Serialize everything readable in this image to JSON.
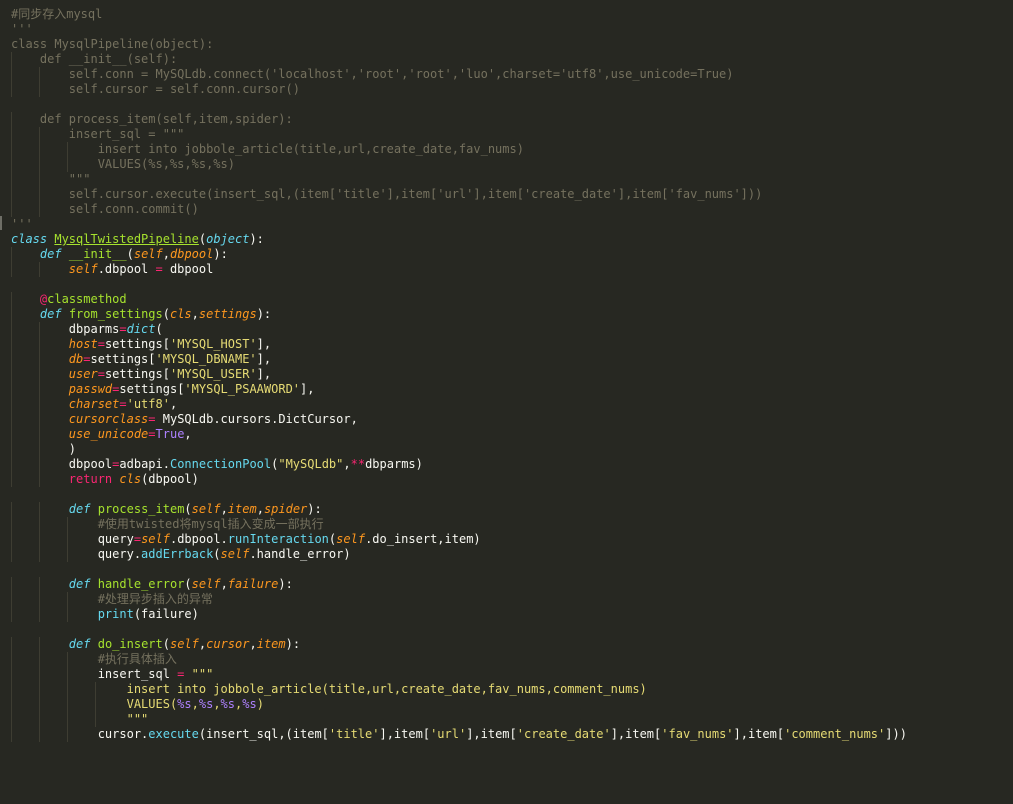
{
  "editor": {
    "theme": {
      "background": "#272822",
      "foreground": "#F8F8F2",
      "comment": "#75715E",
      "keyword": "#66D9EF",
      "operator": "#F92672",
      "function": "#A6E22E",
      "parameter": "#FD971F",
      "string": "#E6DB74",
      "number": "#AE81FF"
    },
    "lines": [
      [
        {
          "t": "#同步存入mysql",
          "c": "com"
        }
      ],
      [
        {
          "t": "'''",
          "c": "com"
        }
      ],
      [
        {
          "t": "class MysqlPipeline(object):",
          "c": "com"
        }
      ],
      [
        {
          "t": "    def __init__(self):",
          "c": "com"
        }
      ],
      [
        {
          "t": "        self.conn = MySQLdb.connect('localhost','root','root','luo',charset='utf8',use_unicode=True)",
          "c": "com"
        }
      ],
      [
        {
          "t": "        self.cursor = self.conn.cursor()",
          "c": "com"
        }
      ],
      [],
      [
        {
          "t": "    def process_item(self,item,spider):",
          "c": "com"
        }
      ],
      [
        {
          "t": "        insert_sql = \"\"\"",
          "c": "com"
        }
      ],
      [
        {
          "t": "            insert into jobbole_article(title,url,create_date,fav_nums)",
          "c": "com"
        }
      ],
      [
        {
          "t": "            VALUES(%s,%s,%s,%s)",
          "c": "com"
        }
      ],
      [
        {
          "t": "        \"\"\"",
          "c": "com"
        }
      ],
      [
        {
          "t": "        self.cursor.execute(insert_sql,(item['title'],item['url'],item['create_date'],item['fav_nums']))",
          "c": "com"
        }
      ],
      [
        {
          "t": "        self.conn.commit()",
          "c": "com"
        }
      ],
      [
        {
          "t": "'''",
          "c": "com"
        }
      ],
      [
        {
          "t": "class",
          "c": "kw"
        },
        {
          "t": " ",
          "c": "txt"
        },
        {
          "t": "MysqlTwistedPipeline",
          "c": "cls"
        },
        {
          "t": "(",
          "c": "txt"
        },
        {
          "t": "object",
          "c": "kw"
        },
        {
          "t": "):",
          "c": "txt"
        }
      ],
      [
        {
          "t": "    ",
          "c": "txt"
        },
        {
          "t": "def",
          "c": "kw"
        },
        {
          "t": " ",
          "c": "txt"
        },
        {
          "t": "__init__",
          "c": "fn"
        },
        {
          "t": "(",
          "c": "txt"
        },
        {
          "t": "self",
          "c": "par"
        },
        {
          "t": ",",
          "c": "txt"
        },
        {
          "t": "dbpool",
          "c": "par"
        },
        {
          "t": "):",
          "c": "txt"
        }
      ],
      [
        {
          "t": "        ",
          "c": "txt"
        },
        {
          "t": "self",
          "c": "self"
        },
        {
          "t": ".dbpool ",
          "c": "txt"
        },
        {
          "t": "=",
          "c": "op"
        },
        {
          "t": " dbpool",
          "c": "txt"
        }
      ],
      [],
      [
        {
          "t": "    ",
          "c": "txt"
        },
        {
          "t": "@",
          "c": "dec"
        },
        {
          "t": "classmethod",
          "c": "fn"
        }
      ],
      [
        {
          "t": "    ",
          "c": "txt"
        },
        {
          "t": "def",
          "c": "kw"
        },
        {
          "t": " ",
          "c": "txt"
        },
        {
          "t": "from_settings",
          "c": "fn"
        },
        {
          "t": "(",
          "c": "txt"
        },
        {
          "t": "cls",
          "c": "par"
        },
        {
          "t": ",",
          "c": "txt"
        },
        {
          "t": "settings",
          "c": "par"
        },
        {
          "t": "):",
          "c": "txt"
        }
      ],
      [
        {
          "t": "        dbparms",
          "c": "txt"
        },
        {
          "t": "=",
          "c": "op"
        },
        {
          "t": "dict",
          "c": "kw"
        },
        {
          "t": "(",
          "c": "txt"
        }
      ],
      [
        {
          "t": "        ",
          "c": "txt"
        },
        {
          "t": "host",
          "c": "par"
        },
        {
          "t": "=",
          "c": "op"
        },
        {
          "t": "settings[",
          "c": "txt"
        },
        {
          "t": "'MYSQL_HOST'",
          "c": "str"
        },
        {
          "t": "],",
          "c": "txt"
        }
      ],
      [
        {
          "t": "        ",
          "c": "txt"
        },
        {
          "t": "db",
          "c": "par"
        },
        {
          "t": "=",
          "c": "op"
        },
        {
          "t": "settings[",
          "c": "txt"
        },
        {
          "t": "'MYSQL_DBNAME'",
          "c": "str"
        },
        {
          "t": "],",
          "c": "txt"
        }
      ],
      [
        {
          "t": "        ",
          "c": "txt"
        },
        {
          "t": "user",
          "c": "par"
        },
        {
          "t": "=",
          "c": "op"
        },
        {
          "t": "settings[",
          "c": "txt"
        },
        {
          "t": "'MYSQL_USER'",
          "c": "str"
        },
        {
          "t": "],",
          "c": "txt"
        }
      ],
      [
        {
          "t": "        ",
          "c": "txt"
        },
        {
          "t": "passwd",
          "c": "par"
        },
        {
          "t": "=",
          "c": "op"
        },
        {
          "t": "settings[",
          "c": "txt"
        },
        {
          "t": "'MYSQL_PSAAWORD'",
          "c": "str"
        },
        {
          "t": "],",
          "c": "txt"
        }
      ],
      [
        {
          "t": "        ",
          "c": "txt"
        },
        {
          "t": "charset",
          "c": "par"
        },
        {
          "t": "=",
          "c": "op"
        },
        {
          "t": "'utf8'",
          "c": "str"
        },
        {
          "t": ",",
          "c": "txt"
        }
      ],
      [
        {
          "t": "        ",
          "c": "txt"
        },
        {
          "t": "cursorclass",
          "c": "par"
        },
        {
          "t": "=",
          "c": "op"
        },
        {
          "t": " MySQLdb.cursors.DictCursor,",
          "c": "txt"
        }
      ],
      [
        {
          "t": "        ",
          "c": "txt"
        },
        {
          "t": "use_unicode",
          "c": "par"
        },
        {
          "t": "=",
          "c": "op"
        },
        {
          "t": "True",
          "c": "num"
        },
        {
          "t": ",",
          "c": "txt"
        }
      ],
      [
        {
          "t": "        )",
          "c": "txt"
        }
      ],
      [
        {
          "t": "        dbpool",
          "c": "txt"
        },
        {
          "t": "=",
          "c": "op"
        },
        {
          "t": "adbapi.",
          "c": "txt"
        },
        {
          "t": "ConnectionPool",
          "c": "bi"
        },
        {
          "t": "(",
          "c": "txt"
        },
        {
          "t": "\"MySQLdb\"",
          "c": "str"
        },
        {
          "t": ",",
          "c": "txt"
        },
        {
          "t": "**",
          "c": "op"
        },
        {
          "t": "dbparms)",
          "c": "txt"
        }
      ],
      [
        {
          "t": "        ",
          "c": "txt"
        },
        {
          "t": "return",
          "c": "kwp"
        },
        {
          "t": " ",
          "c": "txt"
        },
        {
          "t": "cls",
          "c": "par"
        },
        {
          "t": "(dbpool)",
          "c": "txt"
        }
      ],
      [],
      [
        {
          "t": "        ",
          "c": "txt"
        },
        {
          "t": "def",
          "c": "kw"
        },
        {
          "t": " ",
          "c": "txt"
        },
        {
          "t": "process_item",
          "c": "fn"
        },
        {
          "t": "(",
          "c": "txt"
        },
        {
          "t": "self",
          "c": "par"
        },
        {
          "t": ",",
          "c": "txt"
        },
        {
          "t": "item",
          "c": "par"
        },
        {
          "t": ",",
          "c": "txt"
        },
        {
          "t": "spider",
          "c": "par"
        },
        {
          "t": "):",
          "c": "txt"
        }
      ],
      [
        {
          "t": "            ",
          "c": "txt"
        },
        {
          "t": "#使用twisted将mysql插入变成一部执行",
          "c": "com"
        }
      ],
      [
        {
          "t": "            query",
          "c": "txt"
        },
        {
          "t": "=",
          "c": "op"
        },
        {
          "t": "self",
          "c": "self"
        },
        {
          "t": ".dbpool.",
          "c": "txt"
        },
        {
          "t": "runInteraction",
          "c": "bi"
        },
        {
          "t": "(",
          "c": "txt"
        },
        {
          "t": "self",
          "c": "self"
        },
        {
          "t": ".do_insert,item)",
          "c": "txt"
        }
      ],
      [
        {
          "t": "            query.",
          "c": "txt"
        },
        {
          "t": "addErrback",
          "c": "bi"
        },
        {
          "t": "(",
          "c": "txt"
        },
        {
          "t": "self",
          "c": "self"
        },
        {
          "t": ".handle_error)",
          "c": "txt"
        }
      ],
      [],
      [
        {
          "t": "        ",
          "c": "txt"
        },
        {
          "t": "def",
          "c": "kw"
        },
        {
          "t": " ",
          "c": "txt"
        },
        {
          "t": "handle_error",
          "c": "fn"
        },
        {
          "t": "(",
          "c": "txt"
        },
        {
          "t": "self",
          "c": "par"
        },
        {
          "t": ",",
          "c": "txt"
        },
        {
          "t": "failure",
          "c": "par"
        },
        {
          "t": "):",
          "c": "txt"
        }
      ],
      [
        {
          "t": "            ",
          "c": "txt"
        },
        {
          "t": "#处理异步插入的异常",
          "c": "com"
        }
      ],
      [
        {
          "t": "            ",
          "c": "txt"
        },
        {
          "t": "print",
          "c": "bi"
        },
        {
          "t": "(failure)",
          "c": "txt"
        }
      ],
      [],
      [
        {
          "t": "        ",
          "c": "txt"
        },
        {
          "t": "def",
          "c": "kw"
        },
        {
          "t": " ",
          "c": "txt"
        },
        {
          "t": "do_insert",
          "c": "fn"
        },
        {
          "t": "(",
          "c": "txt"
        },
        {
          "t": "self",
          "c": "par"
        },
        {
          "t": ",",
          "c": "txt"
        },
        {
          "t": "cursor",
          "c": "par"
        },
        {
          "t": ",",
          "c": "txt"
        },
        {
          "t": "item",
          "c": "par"
        },
        {
          "t": "):",
          "c": "txt"
        }
      ],
      [
        {
          "t": "            ",
          "c": "txt"
        },
        {
          "t": "#执行具体插入",
          "c": "com"
        }
      ],
      [
        {
          "t": "            insert_sql ",
          "c": "txt"
        },
        {
          "t": "=",
          "c": "op"
        },
        {
          "t": " ",
          "c": "txt"
        },
        {
          "t": "\"\"\"",
          "c": "str"
        }
      ],
      [
        {
          "t": "                ",
          "c": "txt"
        },
        {
          "t": "insert into jobbole_article(title,url,create_date,fav_nums,comment_nums)",
          "c": "str"
        }
      ],
      [
        {
          "t": "                ",
          "c": "txt"
        },
        {
          "t": "VALUES(",
          "c": "str"
        },
        {
          "t": "%s",
          "c": "num"
        },
        {
          "t": ",",
          "c": "str"
        },
        {
          "t": "%s",
          "c": "num"
        },
        {
          "t": ",",
          "c": "str"
        },
        {
          "t": "%s",
          "c": "num"
        },
        {
          "t": ",",
          "c": "str"
        },
        {
          "t": "%s",
          "c": "num"
        },
        {
          "t": ")",
          "c": "str"
        }
      ],
      [
        {
          "t": "                ",
          "c": "txt"
        },
        {
          "t": "\"\"\"",
          "c": "str"
        }
      ],
      [
        {
          "t": "            cursor.",
          "c": "txt"
        },
        {
          "t": "execute",
          "c": "bi"
        },
        {
          "t": "(insert_sql,(item[",
          "c": "txt"
        },
        {
          "t": "'title'",
          "c": "str"
        },
        {
          "t": "],item[",
          "c": "txt"
        },
        {
          "t": "'url'",
          "c": "str"
        },
        {
          "t": "],item[",
          "c": "txt"
        },
        {
          "t": "'create_date'",
          "c": "str"
        },
        {
          "t": "],item[",
          "c": "txt"
        },
        {
          "t": "'fav_nums'",
          "c": "str"
        },
        {
          "t": "],item[",
          "c": "txt"
        },
        {
          "t": "'comment_nums'",
          "c": "str"
        },
        {
          "t": "]))",
          "c": "txt"
        }
      ],
      []
    ]
  }
}
